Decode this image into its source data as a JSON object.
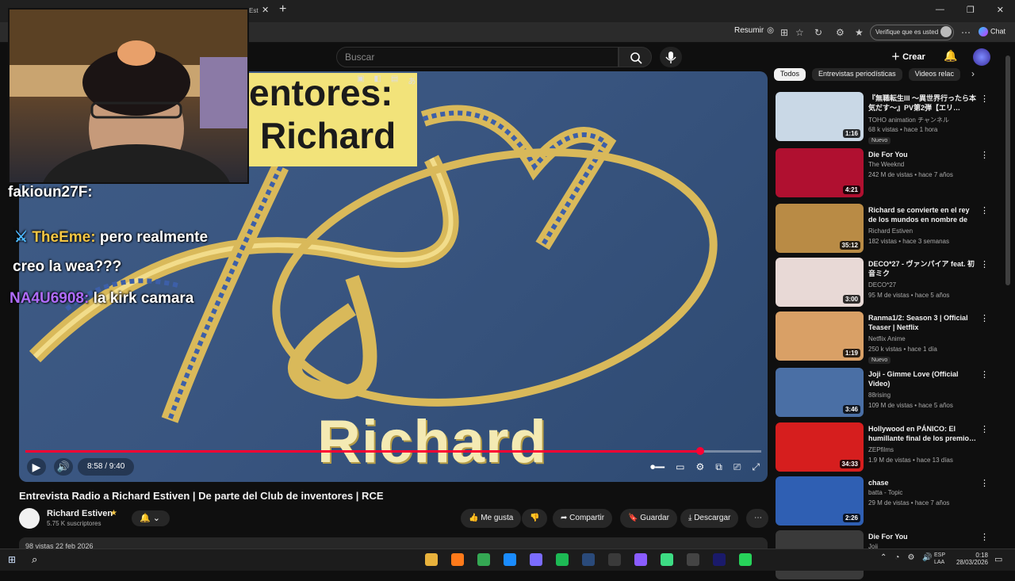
{
  "browser": {
    "tab_label": "Est",
    "tab_close_icon": "✕",
    "new_tab_icon": "+",
    "window_controls": [
      "—",
      "❐",
      "✕"
    ],
    "resumir_label": "Resumir",
    "verify_label": "Verifique que es usted",
    "chat_label": "Chat"
  },
  "youtube": {
    "search_placeholder": "Buscar",
    "create_label": "Crear"
  },
  "player": {
    "thumbnail_top_text": "entores:",
    "thumbnail_mid_text": "Richard",
    "thumbnail_bottom_text": "Richard Estiven",
    "time_display": "8:58 / 9:40",
    "progress_fraction": 0.917,
    "accent_color": "#ff0033"
  },
  "stream_chat": [
    {
      "user": "fakioun27F:",
      "message": ""
    },
    {
      "user": "TheEme:",
      "message": "pero realmente"
    },
    {
      "user": "",
      "message": "creo la wea???"
    },
    {
      "user": "NA4U6908:",
      "message": "la kirk camara"
    }
  ],
  "video": {
    "title": "Entrevista Radio a Richard Estiven | De parte del Club de inventores | RCE",
    "channel": "Richard Estiven",
    "subscribers": "5.75 K suscriptores",
    "views_date": "98 vistas  22 feb 2026",
    "actions": {
      "like": "Me gusta",
      "share": "Compartir",
      "save": "Guardar",
      "download": "Descargar"
    }
  },
  "sidebar": {
    "chips": [
      "Todos",
      "Entrevistas periodísticas",
      "Videos relac"
    ],
    "recommendations": [
      {
        "title": "『無職転生III ～異世界行ったら本気だす～』PV第2弾【エリ…",
        "channel": "TOHO animation チャンネル",
        "meta": "68 k vistas • hace 1 hora",
        "duration": "1:16",
        "badge": "Nuevo",
        "thumb_color": "#c9d8e6"
      },
      {
        "title": "Die For You",
        "channel": "The Weeknd",
        "meta": "242 M de vistas • hace 7 años",
        "duration": "4:21",
        "badge": "",
        "thumb_color": "#b01030"
      },
      {
        "title": "Richard se convierte en el rey de los mundos en nombre de l…",
        "channel": "Richard Estiven",
        "meta": "182 vistas • hace 3 semanas",
        "duration": "35:12",
        "badge": "",
        "thumb_color": "#b98b45"
      },
      {
        "title": "DECO*27 - ヴァンパイア feat. 初音ミク",
        "channel": "DECO*27",
        "meta": "95 M de vistas • hace 5 años",
        "duration": "3:00",
        "badge": "",
        "thumb_color": "#e8d9d6"
      },
      {
        "title": "Ranma1/2: Season 3 | Official Teaser | Netflix",
        "channel": "Netflix Anime",
        "meta": "250 k vistas • hace 1 día",
        "duration": "1:19",
        "badge": "Nuevo",
        "thumb_color": "#d9a066"
      },
      {
        "title": "Joji - Gimme Love (Official Video)",
        "channel": "88rising",
        "meta": "109 M de vistas • hace 5 años",
        "duration": "3:46",
        "badge": "",
        "thumb_color": "#4a6fa5"
      },
      {
        "title": "Hollywood en PÁNICO: El humillante final de los premio…",
        "channel": "ZEPfilms",
        "meta": "1.9 M de vistas • hace 13 días",
        "duration": "34:33",
        "badge": "",
        "thumb_color": "#d61e1e"
      },
      {
        "title": "chase",
        "channel": "batta - Topic",
        "meta": "29 M de vistas • hace 7 años",
        "duration": "2:26",
        "badge": "",
        "thumb_color": "#2f5fb3"
      },
      {
        "title": "Die For You",
        "channel": "Joji",
        "meta": "",
        "duration": "",
        "badge": "",
        "thumb_color": "#3a3a3a"
      }
    ]
  },
  "taskbar": {
    "language": [
      "ESP",
      "LAA"
    ],
    "time": "0:18",
    "date": "28/03/2026",
    "app_colors": [
      "#e8b23c",
      "#ff7a1a",
      "#34a853",
      "#1a8cff",
      "#7b6cff",
      "#1db954",
      "#2a4a7a",
      "#3a3a3a",
      "#8a5cff",
      "#3ddc84",
      "#444444",
      "#1a1a6a",
      "#27d35a"
    ]
  }
}
